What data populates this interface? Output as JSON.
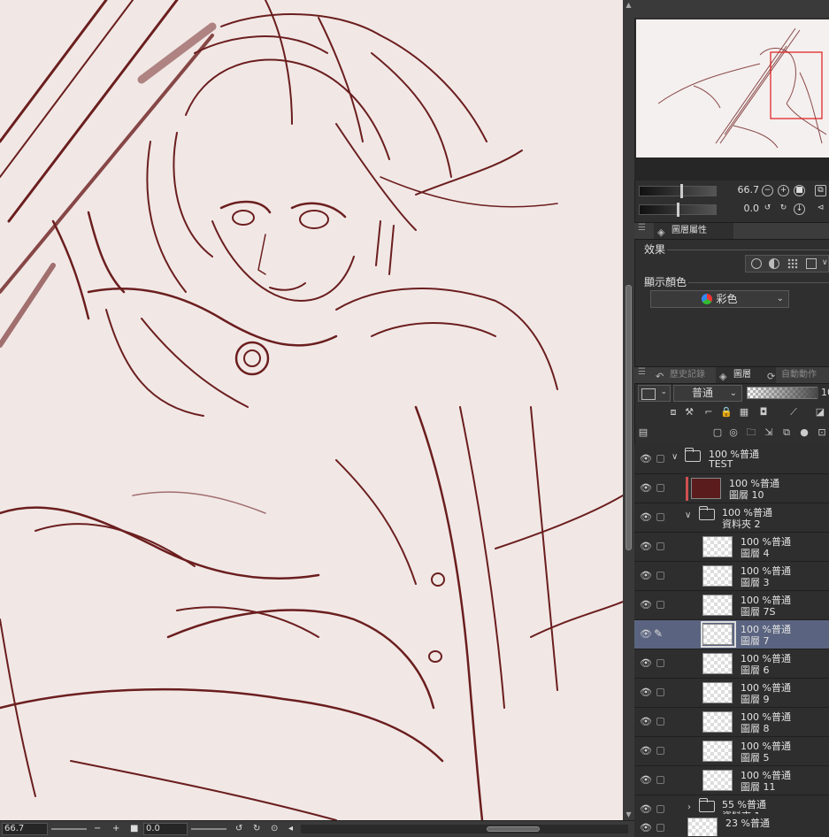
{
  "canvas": {
    "background": "#f1e8e6",
    "ink": "#6b1e1e"
  },
  "status": {
    "zoom": "66.7",
    "rotation": "0.0"
  },
  "navigator": {
    "zoom": "66.7",
    "rotation": "0.0"
  },
  "tabs_top": {
    "layer_property": "圖層屬性"
  },
  "properties": {
    "effect_label": "效果",
    "display_color_label": "顯示顏色",
    "display_color_value": "彩色"
  },
  "tabs_mid": {
    "history": "歷史記錄",
    "layers": "圖層",
    "auto_action": "自動動作"
  },
  "layer_toolbar": {
    "blend_mode": "普通",
    "opacity_partial": "10"
  },
  "layers": [
    {
      "line1": "100 %普通",
      "line2": "TEST",
      "type": "folder",
      "indent": 0,
      "open": true
    },
    {
      "line1": "100 %普通",
      "line2": "圖層 10",
      "type": "solid",
      "indent": 1
    },
    {
      "line1": "100 %普通",
      "line2": "資料夾 2",
      "type": "folder",
      "indent": 1,
      "open": true
    },
    {
      "line1": "100 %普通",
      "line2": "圖層 4",
      "type": "raster",
      "indent": 2
    },
    {
      "line1": "100 %普通",
      "line2": "圖層 3",
      "type": "raster",
      "indent": 2
    },
    {
      "line1": "100 %普通",
      "line2": "圖層 7S",
      "type": "raster",
      "indent": 2
    },
    {
      "line1": "100 %普通",
      "line2": "圖層 7",
      "type": "raster",
      "indent": 2,
      "selected": true
    },
    {
      "line1": "100 %普通",
      "line2": "圖層 6",
      "type": "raster",
      "indent": 2
    },
    {
      "line1": "100 %普通",
      "line2": "圖層 9",
      "type": "raster",
      "indent": 2
    },
    {
      "line1": "100 %普通",
      "line2": "圖層 8",
      "type": "raster",
      "indent": 2
    },
    {
      "line1": "100 %普通",
      "line2": "圖層 5",
      "type": "raster",
      "indent": 2
    },
    {
      "line1": "100 %普通",
      "line2": "圖層 11",
      "type": "raster",
      "indent": 2
    },
    {
      "line1": "55 %普通",
      "line2": "資料夾 1",
      "type": "folder",
      "indent": 1,
      "open": false
    },
    {
      "line1": "23 %普通",
      "line2": "",
      "type": "raster",
      "indent": 0
    }
  ]
}
